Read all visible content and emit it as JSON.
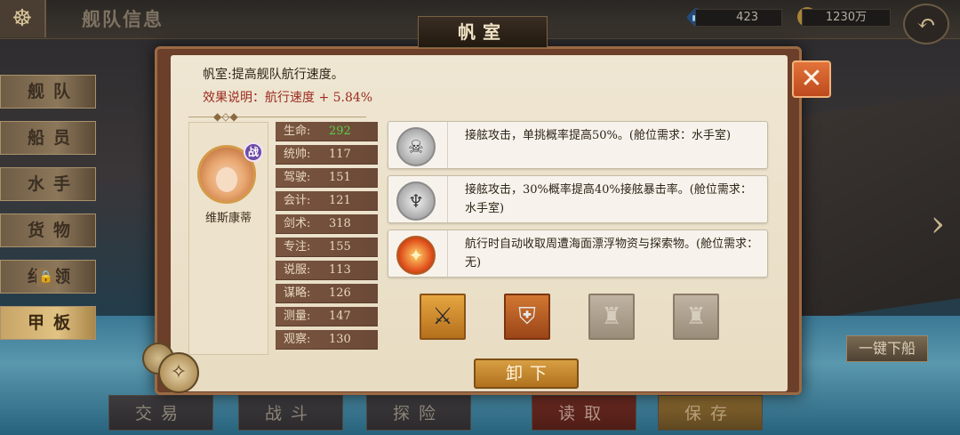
{
  "header": {
    "page_title": "舰队信息",
    "helm_icon": "ship-wheel-icon",
    "gems": "423",
    "gold": "1230万",
    "back_icon": "back-arrow-icon"
  },
  "sidebar": {
    "items": [
      {
        "label": "舰队",
        "active": false
      },
      {
        "label": "船员",
        "active": false
      },
      {
        "label": "水手",
        "active": false
      },
      {
        "label": "货物",
        "active": false
      },
      {
        "label": "纪领",
        "active": false,
        "locked": true
      },
      {
        "label": "甲板",
        "active": true
      }
    ]
  },
  "bottom_bar": {
    "trade": "交易",
    "battle": "战斗",
    "explore": "探险",
    "load": "读取",
    "save": "保存"
  },
  "unload_all_label": "一键下船",
  "modal": {
    "title": "帆室",
    "description": "帆室:提高舰队航行速度。",
    "effect_label": "效果说明：",
    "effect_value": "航行速度 + 5.84%",
    "close_icon": "close-icon",
    "sailor": {
      "name": "维斯康蒂",
      "badge": "战"
    },
    "stats": [
      {
        "label": "生命:",
        "value": "292",
        "highlight": true
      },
      {
        "label": "统帅:",
        "value": "117"
      },
      {
        "label": "驾驶:",
        "value": "151"
      },
      {
        "label": "会计:",
        "value": "121"
      },
      {
        "label": "剑术:",
        "value": "318"
      },
      {
        "label": "专注:",
        "value": "155"
      },
      {
        "label": "说服:",
        "value": "113"
      },
      {
        "label": "谋略:",
        "value": "126"
      },
      {
        "label": "测量:",
        "value": "147"
      },
      {
        "label": "观察:",
        "value": "130"
      }
    ],
    "skills": [
      {
        "icon": "pirate-helmet-icon",
        "text": "接舷攻击，单挑概率提高50%。(舱位需求：水手室)"
      },
      {
        "icon": "horn-icon",
        "text": "接舷攻击，30%概率提高40%接舷暴击率。(舱位需求：水手室)"
      },
      {
        "icon": "fire-treasure-icon",
        "text": "航行时自动收取周遭海面漂浮物资与探索物。(舱位需求：无)"
      }
    ],
    "equipment": [
      {
        "icon": "sword-icon",
        "state": "filled"
      },
      {
        "icon": "armor-icon",
        "state": "filled"
      },
      {
        "icon": "empty-slot-icon",
        "state": "empty"
      },
      {
        "icon": "empty-slot-icon",
        "state": "empty"
      }
    ],
    "unload_label": "卸下"
  }
}
